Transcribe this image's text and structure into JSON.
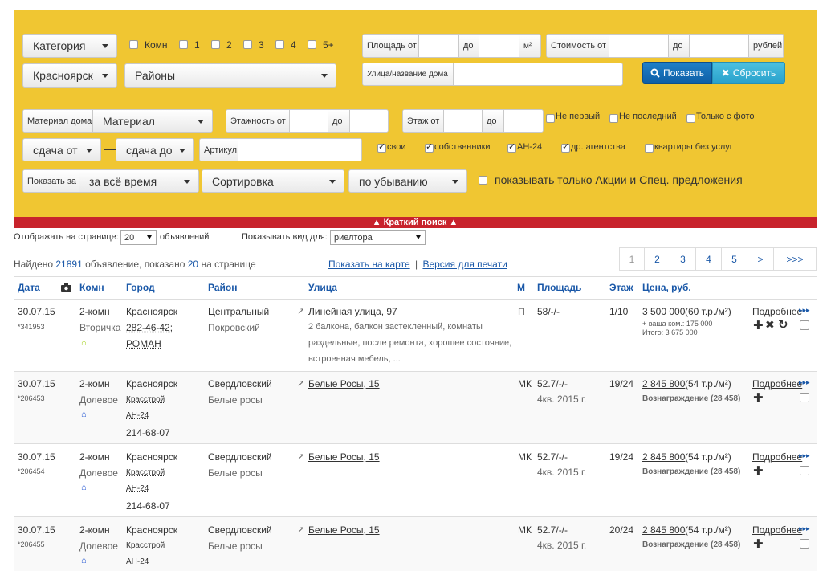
{
  "filter": {
    "category": "Категория",
    "rooms_label": "Комн",
    "rooms": [
      "1",
      "2",
      "3",
      "4",
      "5+"
    ],
    "area_from": "Площадь от",
    "to": "до",
    "area_unit": "м²",
    "price_from": "Стоимость от",
    "price_unit": "рублей",
    "city": "Красноярск",
    "districts": "Районы",
    "street_label": "Улица/название дома",
    "show_button": "Показать",
    "reset_button": "Сбросить",
    "material_label": "Материал дома",
    "material_value": "Материал",
    "floors_label": "Этажность от",
    "floor_label": "Этаж от",
    "not_first": "Не первый",
    "not_last": "Не последний",
    "with_photo": "Только с фото",
    "delivery_from": "сдача от",
    "delivery_to": "сдача до",
    "dash": "—",
    "article_label": "Артикул",
    "own": "свои",
    "owners": "собственники",
    "an24": "АН-24",
    "other_agencies": "др. агентства",
    "no_fee": "квартиры без услуг",
    "show_for_label": "Показать за",
    "period": "за всё время",
    "sort": "Сортировка",
    "order": "по убыванию",
    "promo_only": "показывать только Акции и Спец. предложения"
  },
  "short_search": "▲ Краткий поиск ▲",
  "toolbar": {
    "per_page_label": "Отображать на странице:",
    "per_page": "20",
    "per_page_suffix": "объявлений",
    "view_label": "Показывать вид для:",
    "view_value": "риелтора"
  },
  "summary": {
    "found": "Найдено",
    "count": "21891",
    "found2": "объявление, показано",
    "shown": "20",
    "found3": "на странице",
    "map_link": "Показать на карте",
    "sep": "|",
    "print_link": "Версия для печати"
  },
  "pagination": [
    "1",
    "2",
    "3",
    "4",
    "5",
    ">",
    ">>>"
  ],
  "columns": {
    "date": "Дата",
    "rooms": "Комн",
    "city": "Город",
    "district": "Район",
    "street": "Улица",
    "m": "М",
    "area": "Площадь",
    "floor": "Этаж",
    "price": "Цена, руб."
  },
  "rows": [
    {
      "date": "30.07.15",
      "id": "*341953",
      "rooms": "2-комн",
      "type": "Вторичка",
      "city": "Красноярск",
      "contact1": "282-46-42;",
      "contact2": "РОМАН",
      "contact3": "",
      "district": "Центральный",
      "subdistrict": "Покровский",
      "street": "Линейная улица, 97",
      "desc": [
        "2 балкона, балкон застекленный, комнаты",
        "раздельные, после ремонта, хорошее состояние,",
        "встроенная мебель, ..."
      ],
      "m": "П",
      "area": "58/-/-",
      "area2": "",
      "floor": "1/10",
      "price": "3 500 000",
      "price_per": "(60 т.р./м²)",
      "extra1": "+ ваша ком.: 175 000",
      "extra2": "Итого: 3 675 000",
      "more": "Подробнее"
    },
    {
      "date": "30.07.15",
      "id": "*206453",
      "rooms": "2-комн",
      "type": "Долевое",
      "city": "Красноярск",
      "contact1": "Красстрой",
      "contact2": "АН-24",
      "contact3": "214-68-07",
      "district": "Свердловский",
      "subdistrict": "Белые росы",
      "street": "Белые Росы, 15",
      "desc": [],
      "m": "МК",
      "area": "52.7/-/-",
      "area2": "4кв. 2015 г.",
      "floor": "19/24",
      "price": "2 845 800",
      "price_per": "(54 т.р./м²)",
      "extra1": "Вознаграждение (28 458)",
      "extra2": "",
      "more": "Подробнее"
    },
    {
      "date": "30.07.15",
      "id": "*206454",
      "rooms": "2-комн",
      "type": "Долевое",
      "city": "Красноярск",
      "contact1": "Красстрой",
      "contact2": "АН-24",
      "contact3": "214-68-07",
      "district": "Свердловский",
      "subdistrict": "Белые росы",
      "street": "Белые Росы, 15",
      "desc": [],
      "m": "МК",
      "area": "52.7/-/-",
      "area2": "4кв. 2015 г.",
      "floor": "19/24",
      "price": "2 845 800",
      "price_per": "(54 т.р./м²)",
      "extra1": "Вознаграждение (28 458)",
      "extra2": "",
      "more": "Подробнее"
    },
    {
      "date": "30.07.15",
      "id": "*206455",
      "rooms": "2-комн",
      "type": "Долевое",
      "city": "Красноярск",
      "contact1": "Красстрой",
      "contact2": "АН-24",
      "contact3": "",
      "district": "Свердловский",
      "subdistrict": "Белые росы",
      "street": "Белые Росы, 15",
      "desc": [],
      "m": "МК",
      "area": "52.7/-/-",
      "area2": "4кв. 2015 г.",
      "floor": "20/24",
      "price": "2 845 800",
      "price_per": "(54 т.р./м²)",
      "extra1": "Вознаграждение (28 458)",
      "extra2": "",
      "more": "Подробнее"
    }
  ]
}
